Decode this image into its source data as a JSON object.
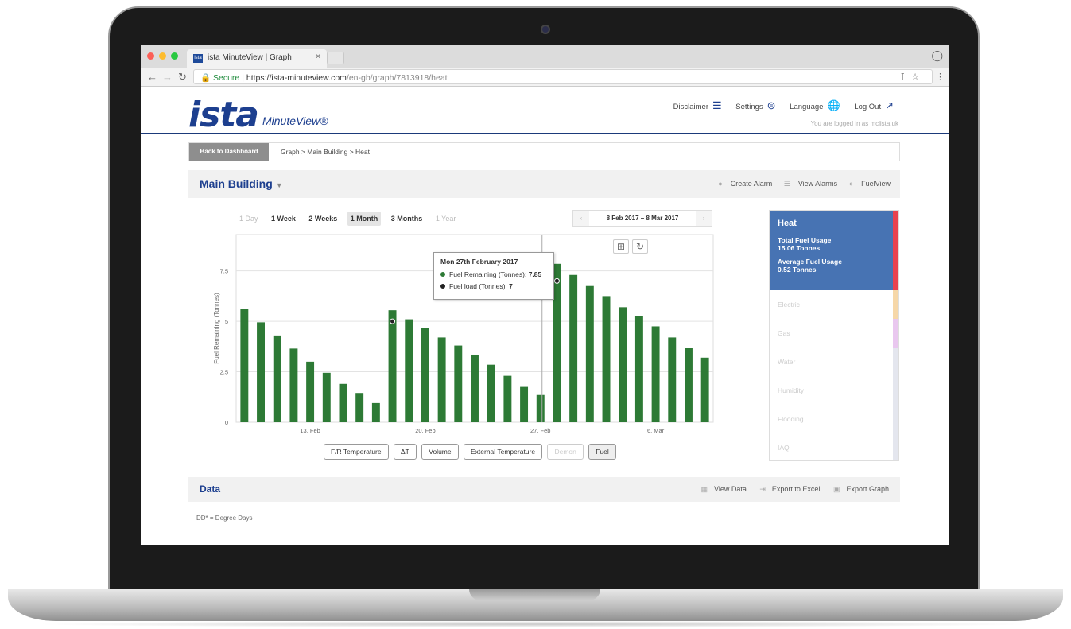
{
  "browser": {
    "tab_title": "ista MinuteView | Graph",
    "tab_favicon": "ista",
    "tab_close": "×",
    "secure_label": "Secure",
    "url_host": "https://ista-minuteview.com",
    "url_path": "/en-gb/graph/7813918/heat",
    "traffic_colors": [
      "#fc5f57",
      "#fdbc2e",
      "#28c840"
    ]
  },
  "header": {
    "logo": "ista",
    "logo_sub": "MinuteView®",
    "nav": [
      {
        "label": "Disclaimer",
        "icon": "list-icon"
      },
      {
        "label": "Settings",
        "icon": "sliders-icon"
      },
      {
        "label": "Language",
        "icon": "globe-icon"
      },
      {
        "label": "Log Out",
        "icon": "external-link-icon"
      }
    ],
    "logged_in": "You are logged in as mclista.uk"
  },
  "breadcrumb": {
    "back_label": "Back to Dashboard",
    "path": "Graph > Main Building > Heat"
  },
  "titlebar": {
    "title": "Main Building",
    "actions": [
      "Create Alarm",
      "View Alarms",
      "FuelView"
    ]
  },
  "ranges": {
    "items": [
      "1 Day",
      "1 Week",
      "2 Weeks",
      "1 Month",
      "3 Months",
      "1 Year"
    ],
    "active": "1 Month",
    "disabled": [
      "1 Day",
      "1 Year"
    ]
  },
  "date_range": {
    "from": "8 Feb 2017",
    "separator": "–",
    "to": "8 Mar 2017",
    "prev": "‹",
    "next": "›"
  },
  "chart_data": {
    "type": "bar",
    "ylabel": "Fuel Remaining (Tonnes)",
    "ylim": [
      0,
      10
    ],
    "yticks": [
      "0",
      "2.5",
      "5",
      "7.5"
    ],
    "ytick_values": [
      0,
      2.5,
      5,
      7.5
    ],
    "xticks": [
      "13. Feb",
      "20. Feb",
      "27. Feb",
      "6. Mar"
    ],
    "xtick_index": [
      4.5,
      11.5,
      18.5,
      25.5
    ],
    "values": [
      5.6,
      4.95,
      4.3,
      3.65,
      3.0,
      2.45,
      1.9,
      1.45,
      0.95,
      5.55,
      5.1,
      4.65,
      4.2,
      3.8,
      3.35,
      2.85,
      2.3,
      1.75,
      1.35,
      7.85,
      7.3,
      6.75,
      6.25,
      5.7,
      5.25,
      4.75,
      4.2,
      3.7,
      3.2
    ],
    "color": "#2d7a35",
    "fuel_load_markers": [
      {
        "index": 9,
        "value": 5
      },
      {
        "index": 19,
        "value": 7
      }
    ],
    "highlight_index": 19
  },
  "tooltip": {
    "title": "Mon 27th February 2017",
    "row1_label": "Fuel Remaining (Tonnes): ",
    "row1_value": "7.85",
    "row2_label": "Fuel load (Tonnes): ",
    "row2_value": "7",
    "row1_color": "#2d7a35",
    "row2_color": "#222"
  },
  "chart_tools": [
    "crop-icon",
    "refresh-icon"
  ],
  "legend": [
    "F/R Temperature",
    "ΔT",
    "Volume",
    "External Temperature",
    "Demon",
    "Fuel"
  ],
  "legend_disabled": [
    "Demon"
  ],
  "legend_active": [
    "Fuel"
  ],
  "panel": {
    "heading": "Heat",
    "total_label": "Total Fuel Usage",
    "total_value": "15.06 Tonnes",
    "avg_label": "Average Fuel Usage",
    "avg_value": "0.52 Tonnes",
    "items": [
      "Electric",
      "Gas",
      "Water",
      "Humidity",
      "Flooding",
      "IAQ"
    ]
  },
  "data_section": {
    "title": "Data",
    "actions": [
      "View Data",
      "Export to Excel",
      "Export Graph"
    ],
    "note": "DD* = Degree Days"
  }
}
